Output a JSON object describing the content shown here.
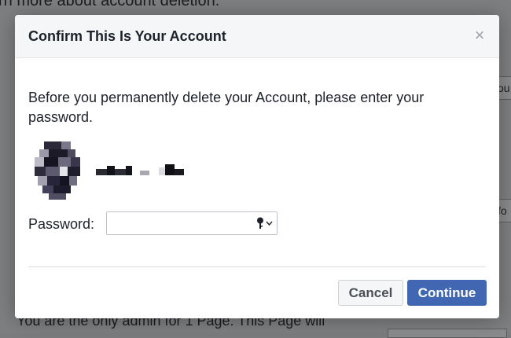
{
  "background": {
    "top_text": "rn more about account deletion.",
    "bottom_text": "You are the only admin for 1 Page. This Page will",
    "right_button_a": "ou",
    "right_button_b": "fo"
  },
  "dialog": {
    "title": "Confirm This Is Your Account",
    "close_icon": "×",
    "instruction": "Before you permanently delete your Account, please enter your password.",
    "password_label": "Password:",
    "password_value": "",
    "password_placeholder": "",
    "cancel_label": "Cancel",
    "continue_label": "Continue"
  },
  "colors": {
    "primary_button": "#4267b2",
    "header_bg": "#f5f6f7"
  }
}
